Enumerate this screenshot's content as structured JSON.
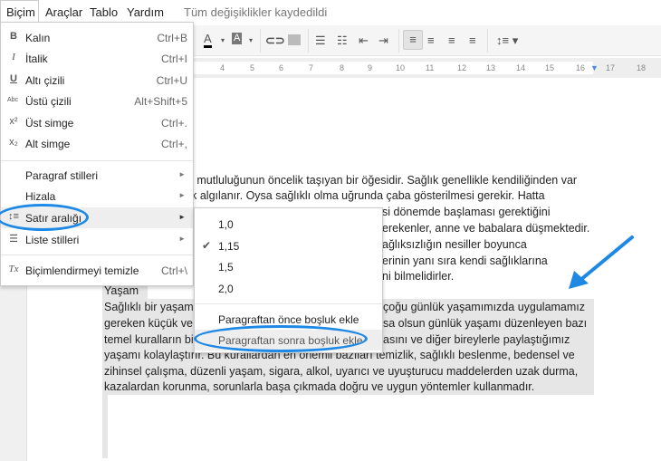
{
  "menubar": {
    "items": [
      "Biçim",
      "Araçlar",
      "Tablo",
      "Yardım"
    ],
    "status": "Tüm değişiklikler kaydedildi"
  },
  "toolbar": {
    "icons": [
      "text-color-icon",
      "highlight-color-icon",
      "link-icon",
      "image-icon",
      "numbered-list-icon",
      "bulleted-list-icon",
      "decrease-indent-icon",
      "increase-indent-icon",
      "align-left-icon",
      "align-center-icon",
      "align-right-icon",
      "justify-icon",
      "line-spacing-icon"
    ],
    "text_color": "A",
    "highlight": "A"
  },
  "ruler": {
    "numbers": [
      "4",
      "5",
      "6",
      "7",
      "8",
      "9",
      "10",
      "11",
      "12",
      "13",
      "14",
      "15",
      "16",
      "17",
      "18"
    ]
  },
  "format_menu": {
    "items": [
      {
        "icon": "B",
        "label": "Kalın",
        "shortcut": "Ctrl+B"
      },
      {
        "icon": "I",
        "label": "İtalik",
        "shortcut": "Ctrl+I"
      },
      {
        "icon": "U",
        "label": "Altı çizili",
        "shortcut": "Ctrl+U"
      },
      {
        "icon": "Abc",
        "label": "Üstü çizili",
        "shortcut": "Alt+Shift+5"
      },
      {
        "icon": "x²",
        "label": "Üst simge",
        "shortcut": "Ctrl+."
      },
      {
        "icon": "x₂",
        "label": "Alt simge",
        "shortcut": "Ctrl+,"
      },
      {
        "label": "Paragraf stilleri"
      },
      {
        "label": "Hizala"
      },
      {
        "label": "Satır aralığı"
      },
      {
        "label": "Liste stilleri"
      },
      {
        "icon": "Tx",
        "label": "Biçimlendirmeyi temizle",
        "shortcut": "Ctrl+\\"
      }
    ]
  },
  "line_spacing_menu": {
    "items": [
      "1,0",
      "1,15",
      "1,5",
      "2,0",
      "Paragraftan önce boşluk ekle",
      "Paragraftan sonra boşluk ekle"
    ],
    "checked": "1,15"
  },
  "document": {
    "para1": [
      "an mutluluğunun öncelik taşıyan bir öğesidir. Sağlık genellikle kendiliğinden var",
      "rak algılanır. Oysa sağlıklı olma uğrunda çaba gösterilmesi gerekir. Hatta",
      "si dönemde başlaması gerektiğini",
      "erekenler, anne ve babalara düşmektedir.",
      "ağlıksızlığın nesiller boyunca",
      "erinin yanı sıra kendi sağlıklarına",
      "ni bilmelidirler."
    ],
    "heading": "Yaşam",
    "para2_left": [
      "Sağlıklı bir yaşam",
      "gereken küçük ve",
      "temel kuralların bi"
    ],
    "para2_right": [
      "çoğu günlük yaşamımızda  uygulamamız",
      "sa olsun günlük yaşamı düzenleyen bazı",
      "asını ve diğer bireylerle paylaştığımız"
    ],
    "para2_full": [
      "yaşamı kolaylaştırır. Bu kurallardan en önemli bazıları temizlik, sağlıklı beslenme, bedensel ve",
      "zihinsel çalışma, düzenli yaşam, sigara, alkol, uyarıcı ve uyuşturucu maddelerden uzak durma,",
      "kazalardan korunma, sorunlarla başa çıkmada doğru ve uygun yöntemler kullanmadır."
    ]
  },
  "annotation_color": "#1e88e5"
}
